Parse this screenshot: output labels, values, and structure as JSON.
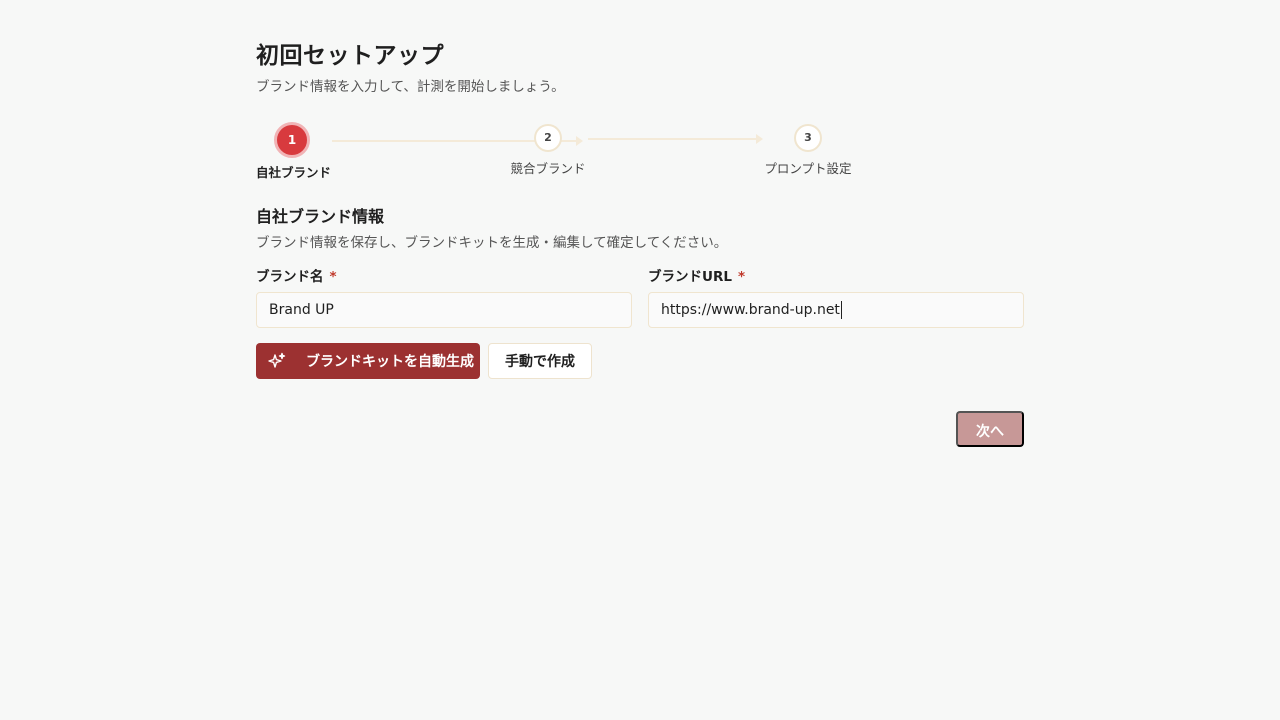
{
  "header": {
    "title": "初回セットアップ",
    "subtitle": "ブランド情報を入力して、計測を開始しましょう。"
  },
  "stepper": {
    "steps": [
      {
        "number": "1",
        "label": "自社ブランド",
        "state": "active"
      },
      {
        "number": "2",
        "label": "競合ブランド",
        "state": "inactive"
      },
      {
        "number": "3",
        "label": "プロンプト設定",
        "state": "inactive"
      }
    ]
  },
  "section": {
    "title": "自社ブランド情報",
    "description": "ブランド情報を保存し、ブランドキットを生成・編集して確定してください。"
  },
  "form": {
    "brand_name": {
      "label": "ブランド名",
      "required_mark": "*",
      "value": "Brand UP"
    },
    "brand_url": {
      "label": "ブランドURL",
      "required_mark": "*",
      "value": "https://www.brand-up.net"
    }
  },
  "actions": {
    "auto_generate_label": "ブランドキットを自動生成",
    "auto_generate_icon": "sparkles-icon",
    "manual_create_label": "手動で作成",
    "next_label": "次へ"
  },
  "colors": {
    "accent": "#9c3131",
    "step_active": "#d83a3e",
    "next_disabled": "#c79897",
    "required": "#c0392b"
  }
}
